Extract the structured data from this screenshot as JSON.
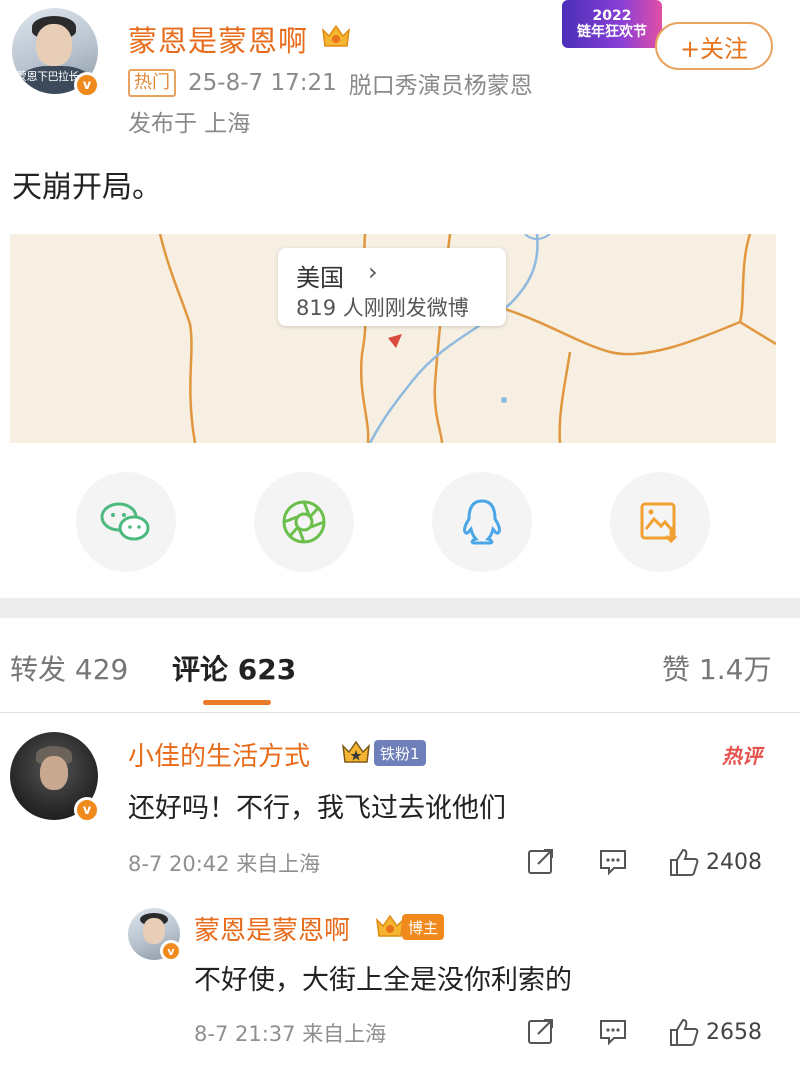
{
  "post": {
    "username": "蒙恩是蒙恩啊",
    "hot_tag": "热门",
    "datetime": "25-8-7 17:21",
    "bio": "脱口秀演员杨蒙恩",
    "location": "发布于 上海",
    "content": "天崩开局。",
    "follow_label": "+关注",
    "promo_year": "2022",
    "promo_text": "链年狂欢节",
    "avatar_caption": "蒙恩下巴拉长"
  },
  "map": {
    "place": "美国",
    "count_text": "819 人刚刚发微博"
  },
  "share": [
    {
      "icon": "wechat-icon",
      "color": "#4cba7f"
    },
    {
      "icon": "moments-icon",
      "color": "#6cbf4b"
    },
    {
      "icon": "qq-icon",
      "color": "#4aa6e6"
    },
    {
      "icon": "save-image-icon",
      "color": "#f0a030"
    }
  ],
  "tabs": {
    "repost": {
      "label": "转发",
      "count": "429"
    },
    "comment": {
      "label": "评论",
      "count": "623"
    },
    "like": {
      "label": "赞",
      "count": "1.4万"
    }
  },
  "comments": [
    {
      "username": "小佳的生活方式",
      "badge": "铁粉1",
      "tag": "热评",
      "text": "还好吗！不行，我飞过去讹他们",
      "time": "8-7 20:42",
      "from": "来自上海",
      "likes": "2408"
    },
    {
      "username": "蒙恩是蒙恩啊",
      "badge": "博主",
      "text": "不好使，大街上全是没你利索的",
      "time": "8-7 21:37",
      "from": "来自上海",
      "likes": "2658"
    }
  ],
  "colors": {
    "accent": "#e86b1a",
    "brand_orange": "#f08a1d"
  }
}
